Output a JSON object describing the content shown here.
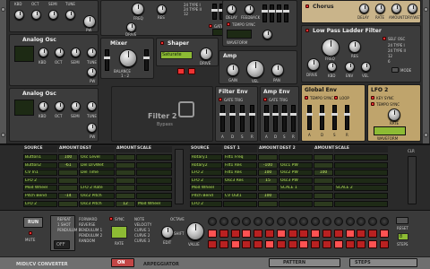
{
  "osc_top": {
    "labels": [
      "KBD",
      "Oct",
      "Semi",
      "Tune",
      "PW"
    ]
  },
  "analog_osc_1": {
    "title": "Analog Osc",
    "labels": [
      "KBD",
      "Oct",
      "Semi",
      "Tune",
      "PW"
    ]
  },
  "analog_osc_2": {
    "title": "Analog Osc",
    "labels": [
      "KBD",
      "Oct",
      "Semi",
      "Tune",
      "PW"
    ]
  },
  "filter_top": {
    "labels": [
      "FREQ",
      "RES",
      "DRIVE",
      "GATE TRIG",
      "MODE",
      "FREQ",
      "RES"
    ],
    "modes": [
      "24 TYPE I",
      "24 TYPE II",
      "12",
      "6"
    ]
  },
  "delay_top": {
    "labels": [
      "DELAY",
      "FEEDBACK",
      "TEMPO SYNC",
      "LOOP",
      "WAVEFORM",
      "DRY/WET"
    ]
  },
  "mixer": {
    "title": "Mixer",
    "balance_label": "BALANCE",
    "balance_value": "1 - 2",
    "labels": [
      "1",
      "2"
    ]
  },
  "shaper": {
    "title": "Shaper",
    "mode": "Saturate",
    "drive_label": "DRIVE"
  },
  "amp": {
    "title": "Amp",
    "labels": [
      "GAIN",
      "VEL",
      "PAN"
    ]
  },
  "filter2": {
    "title": "Filter 2",
    "subtitle": "Bypass"
  },
  "filter_env": {
    "title": "Filter Env",
    "gate": "GATE TRIG",
    "adsr": [
      "A",
      "D",
      "S",
      "R"
    ]
  },
  "amp_env": {
    "title": "Amp Env",
    "gate": "GATE TRIG",
    "adsr": [
      "A",
      "D",
      "S",
      "R"
    ]
  },
  "chorus": {
    "title": "Chorus",
    "labels": [
      "DELAY",
      "RATE",
      "AMOUNT",
      "DRY/WET"
    ]
  },
  "ladder": {
    "title": "Low Pass Ladder Filter",
    "labels": [
      "FREQ",
      "RES",
      "DRIVE",
      "KBD",
      "ENV",
      "VEL"
    ],
    "self_osc": "SELF OSC",
    "types": [
      "24 TYPE I",
      "24 TYPE II",
      "12",
      "6"
    ],
    "mode": "MODE"
  },
  "global_env": {
    "title": "Global Env",
    "labels": [
      "TEMPO SYNC",
      "LOOP",
      "GATE TRIG"
    ],
    "adsr": [
      "A",
      "D",
      "S",
      "R"
    ]
  },
  "lfo2": {
    "title": "LFO 2",
    "labels": [
      "KEY SYNC",
      "TEMPO SYNC",
      "RATE"
    ],
    "waveform": "WAVEFORM"
  },
  "mod_left": {
    "headers": [
      "SOURCE",
      "AMOUNT",
      "DEST",
      "AMOUNT",
      "SCALE"
    ],
    "rows": [
      {
        "src": "Button1",
        "amt": "100",
        "dest": "Osc Level",
        "amt2": "",
        "scale": ""
      },
      {
        "src": "Button2",
        "amt": "-61",
        "dest": "Del DrvWet",
        "amt2": "",
        "scale": ""
      },
      {
        "src": "CV In1",
        "amt": "",
        "dest": "Del Time",
        "amt2": "",
        "scale": ""
      },
      {
        "src": "LFO 2",
        "amt": "",
        "dest": "",
        "amt2": "",
        "scale": ""
      },
      {
        "src": "Mod Wheel",
        "amt": "",
        "dest": "LFO 2 Rate",
        "amt2": "",
        "scale": ""
      },
      {
        "src": "Pitch Bend",
        "amt": "-14",
        "dest": "Osc2 Pitch",
        "amt2": "",
        "scale": ""
      },
      {
        "src": "LFO 2",
        "amt": "",
        "dest": "Osc3 Pitch",
        "amt2": "12",
        "scale": "Mod Wheel"
      }
    ]
  },
  "mod_right": {
    "headers": [
      "SOURCE",
      "DEST 1",
      "AMOUNT",
      "DEST 2",
      "AMOUNT",
      "SCALE"
    ],
    "rows": [
      {
        "src": "Rotary1",
        "amt": "",
        "dest": "Filt1 Freq",
        "amt2": "",
        "dest2": "",
        "scale": ""
      },
      {
        "src": "Rotary2",
        "amt": "-100",
        "dest": "Filt1 Res",
        "amt2": "",
        "dest2": "Osc1 PW",
        "scale": ""
      },
      {
        "src": "LFO 2",
        "amt": "100",
        "dest": "Filt1 Res",
        "amt2": "100",
        "dest2": "Osc2 PW",
        "scale": ""
      },
      {
        "src": "LFO 2",
        "amt": "15",
        "dest": "Osc3 Res",
        "amt2": "",
        "dest2": "Osc3 PW",
        "scale": ""
      },
      {
        "src": "Mod Wheel",
        "amt": "",
        "dest": "",
        "amt2": "",
        "dest2": "SCALE 1",
        "scale": "SCALE 2"
      },
      {
        "src": "Pitch Bend",
        "amt": "100",
        "dest": "CV Out1",
        "amt2": "",
        "dest2": "",
        "scale": ""
      },
      {
        "src": "LFO 2",
        "amt": "",
        "dest": "",
        "amt2": "",
        "dest2": "",
        "scale": ""
      }
    ],
    "clr": "CLR"
  },
  "arp": {
    "run": "RUN",
    "mute": "MUTE",
    "off": "OFF",
    "octave_modes": [
      "REPEAT",
      "1 SHOT",
      "PENDULUM 1",
      "PENDULUM 2"
    ],
    "direction": [
      "FORWARD",
      "REVERSE",
      "PENDULUM 1",
      "PENDULUM 2",
      "RANDOM"
    ],
    "sync": "SYNC",
    "rate": "RATE",
    "curves": [
      "NOTE",
      "VELOCITY",
      "CURVE 1",
      "CURVE 2",
      "CURVE 3"
    ],
    "octave_label": "OCTAVE",
    "edit": "EDIT",
    "shift": "SHIFT",
    "gate": "GATE",
    "value": "VALUE",
    "reset": "RESET",
    "steps": "STEPS",
    "steps_value": "8"
  },
  "bottom": {
    "left_title": "MIDI/CV CONVERTER",
    "on_button": "ON",
    "arp_title": "ARPEGGIATOR",
    "pattern": "PATTERN",
    "steps_label": "STEPS"
  }
}
